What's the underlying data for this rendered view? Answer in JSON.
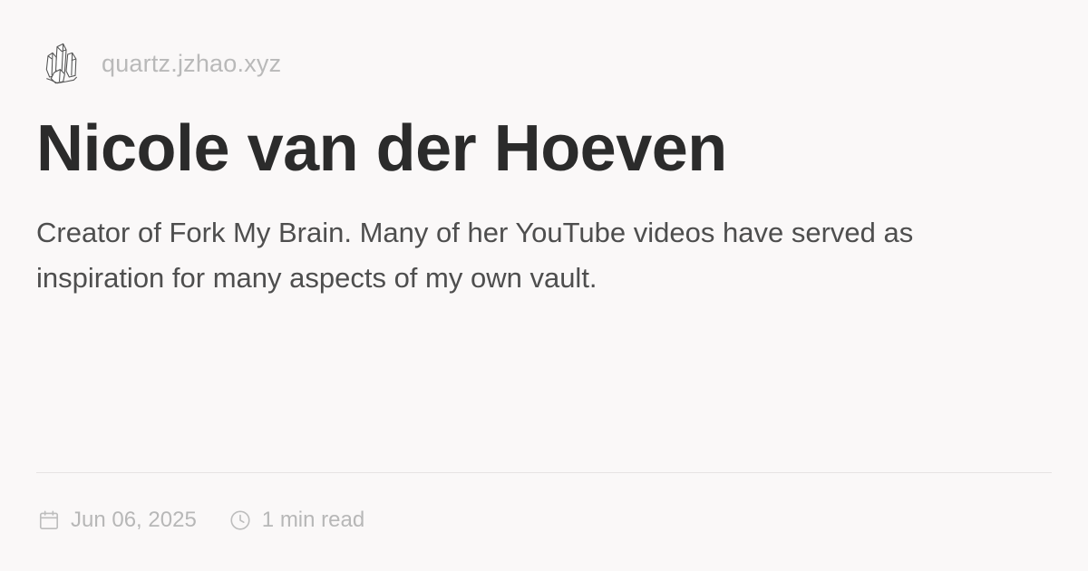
{
  "site": {
    "domain": "quartz.jzhao.xyz",
    "logo_icon": "crystal-cluster-icon"
  },
  "page": {
    "title": "Nicole van der Hoeven",
    "description": "Creator of Fork My Brain. Many of her YouTube videos have served as inspiration for many aspects of my own vault."
  },
  "meta": {
    "date": "Jun 06, 2025",
    "date_icon": "calendar-icon",
    "reading_time": "1 min read",
    "reading_time_icon": "clock-icon"
  },
  "colors": {
    "background": "#faf8f8",
    "title": "#2b2b2b",
    "description": "#4e4e4e",
    "muted": "#b9b9b9"
  }
}
